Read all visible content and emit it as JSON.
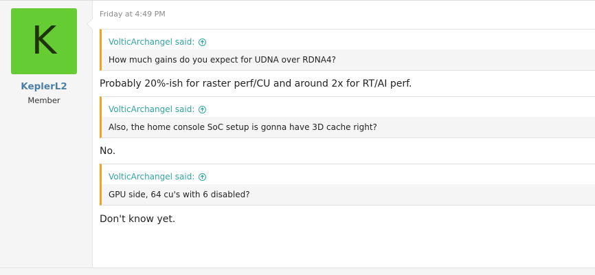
{
  "author": {
    "avatar_letter": "K",
    "username": "KeplerL2",
    "title": "Member"
  },
  "post": {
    "date": "Friday at 4:49 PM",
    "blocks": [
      {
        "quote_author": "VolticArchangel said:",
        "quote_text": "How much gains do you expect for UDNA over RDNA4?",
        "reply": "Probably 20%-ish for raster perf/CU and around 2x for RT/AI perf."
      },
      {
        "quote_author": "VolticArchangel said:",
        "quote_text": "Also, the home console SoC setup is gonna have 3D cache right?",
        "reply": "No."
      },
      {
        "quote_author": "VolticArchangel said:",
        "quote_text": "GPU side, 64 cu's with 6 disabled?",
        "reply": "Don't know yet."
      }
    ]
  },
  "colors": {
    "avatar_bg": "#66cc33",
    "quote_accent": "#f6a11b",
    "quote_author": "#2fa59e",
    "username": "#4b7fa8"
  },
  "icons": {
    "quote_jump": "arrow-up-circle-icon"
  }
}
